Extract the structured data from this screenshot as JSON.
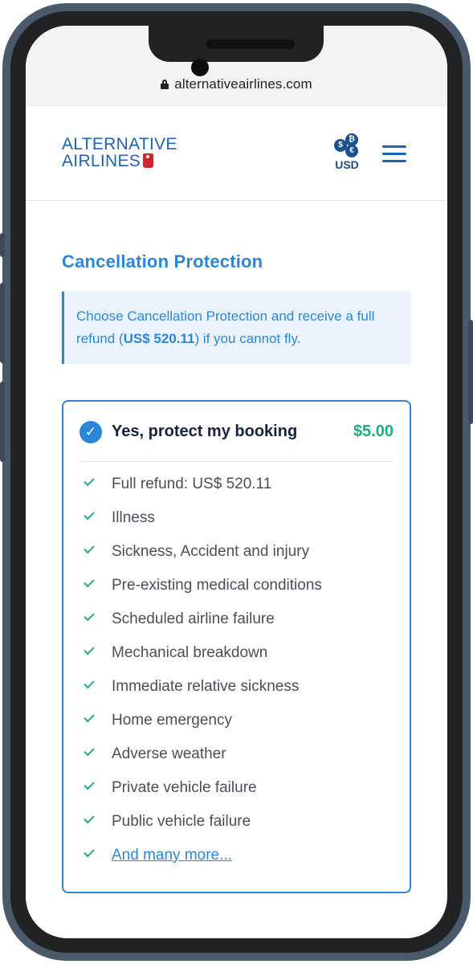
{
  "browser": {
    "url": "alternativeairlines.com"
  },
  "header": {
    "logo_line1": "ALTERNATIVE",
    "logo_line2": "AIRLINES",
    "currency_code": "USD",
    "currency_symbols": [
      "$",
      "₿",
      "€"
    ],
    "menu_icon": "hamburger-icon"
  },
  "section": {
    "title": "Cancellation Protection",
    "info_prefix": "Choose Cancellation Protection and receive a full refund (",
    "info_amount": "US$ 520.11",
    "info_suffix": ") if you cannot fly."
  },
  "option": {
    "label": "Yes, protect my booking",
    "price": "$5.00",
    "selected": true,
    "benefits": [
      "Full refund: US$ 520.11",
      "Illness",
      "Sickness, Accident and injury",
      "Pre-existing medical conditions",
      "Scheduled airline failure",
      "Mechanical breakdown",
      "Immediate relative sickness",
      "Home emergency",
      "Adverse weather",
      "Private vehicle failure",
      "Public vehicle failure"
    ],
    "more_link": "And many more..."
  },
  "colors": {
    "accent": "#2b86d8",
    "brand": "#1b64b8",
    "price": "#1fae79",
    "info_bg": "#ebf4fd"
  }
}
